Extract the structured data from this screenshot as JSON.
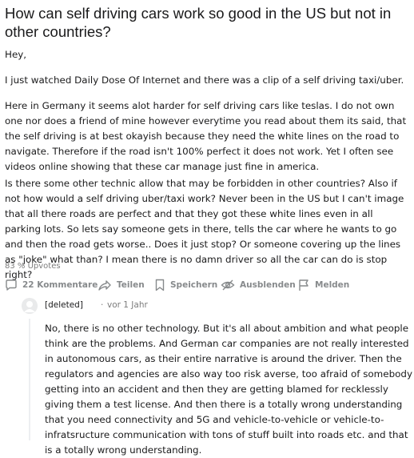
{
  "post": {
    "title": "How can self driving cars work so good in the US but not in other countries?",
    "paragraphs": [
      "Hey,",
      "I just watched Daily Dose Of Internet and there was a clip of a self driving taxi/uber.",
      "Here in Germany it seems alot harder for self driving cars like teslas. I do not own one nor does a friend of mine however everytime you read about them its said, that the self driving is at best okayish because they need the white lines on the road to navigate. Therefore if the road isn't 100% perfect it does not work. Yet I often see videos online showing that these car manage just fine in america.",
      "Is there some other technic allow that may be forbidden in other countries? Also if not how would a self driving uber/taxi work? Never been in the US but I can't image that all there roads are perfect and that they got these white lines even in all parking lots. So lets say someone gets in there, tells the car where he wants to go and then the road gets worse.. Does it just stop? Or someone covering up the lines as \"joke\" what than? I mean there is no damn driver so all the car can do is stop right?"
    ],
    "upvote_ratio": "83 % Upvotes"
  },
  "actions": {
    "comments": {
      "label": "22 Kommentare",
      "icon": "comment-icon"
    },
    "share": {
      "label": "Teilen",
      "icon": "share-icon"
    },
    "save": {
      "label": "Speichern",
      "icon": "bookmark-icon"
    },
    "hide": {
      "label": "Ausblenden",
      "icon": "hide-icon"
    },
    "report": {
      "label": "Melden",
      "icon": "flag-icon"
    }
  },
  "comment": {
    "author": "[deleted]",
    "separator": "·",
    "time": "vor 1 Jahr",
    "body": "No, there is no other technology. But it's all about ambition and what people think are the problems. And German car companies are not really interested in autonomous cars, as their entire narrative is around the driver. Then the regulators and agencies are also way too risk averse, too afraid of somebody getting into an accident and then they are getting blamed for recklessly giving them a test license. And then there is a totally wrong understanding that you need connectivity and 5G and vehicle-to-vehicle or vehicle-to-infratsructure communication with tons of stuff built into roads etc. and that is a totally wrong understanding."
  },
  "colors": {
    "text": "#1a1a1b",
    "meta": "#7c7c7c",
    "action": "#878a8c",
    "avatar_bg": "#e9eaeb",
    "thread_line": "#edeff1"
  }
}
